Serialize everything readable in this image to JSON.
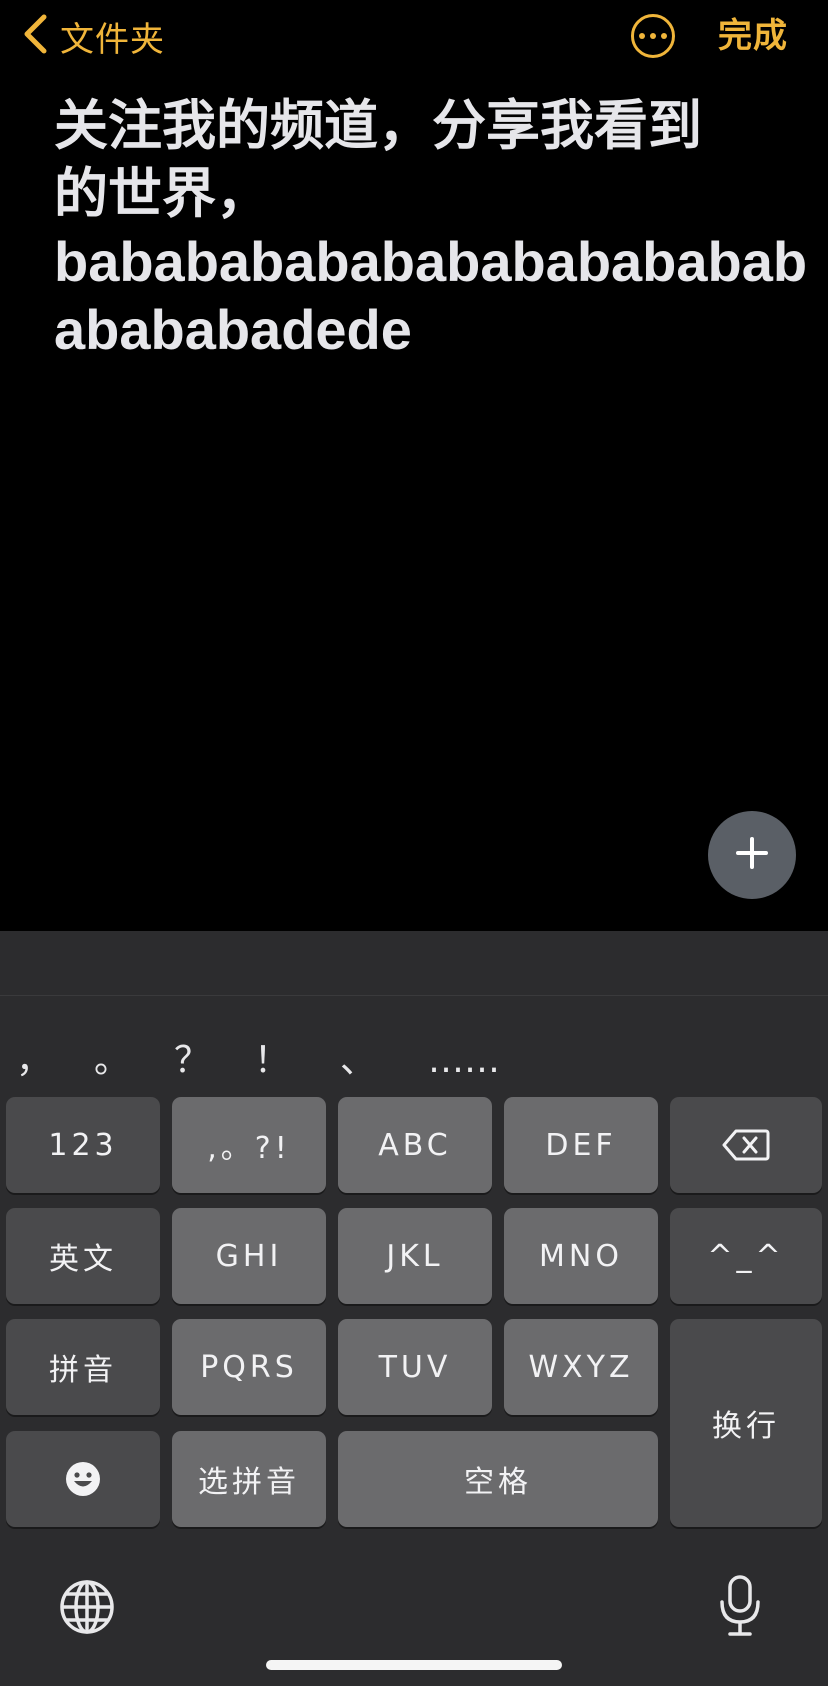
{
  "header": {
    "back_label": "文件夹",
    "done_label": "完成"
  },
  "note": {
    "lines": [
      "关注我的频道，分享我看到",
      "的世界，",
      "bababababababababababab",
      "abababadede"
    ]
  },
  "keyboard": {
    "punctuation": [
      "，",
      "。",
      "？",
      "！",
      "、",
      "……"
    ],
    "keys": {
      "numbers": "123",
      "punct": ",。?!",
      "abc": "ABC",
      "def": "DEF",
      "english": "英文",
      "ghi": "GHI",
      "jkl": "JKL",
      "mno": "MNO",
      "emoticon": "^_^",
      "pinyin": "拼音",
      "pqrs": "PQRS",
      "tuv": "TUV",
      "wxyz": "WXYZ",
      "return": "换行",
      "select_pinyin": "选拼音",
      "space": "空格"
    }
  },
  "colors": {
    "accent": "#f0b53a",
    "background": "#000000",
    "keyboard_bg": "#2c2c2e",
    "key_light": "#6b6b6d",
    "key_dark": "#4a4a4c"
  }
}
